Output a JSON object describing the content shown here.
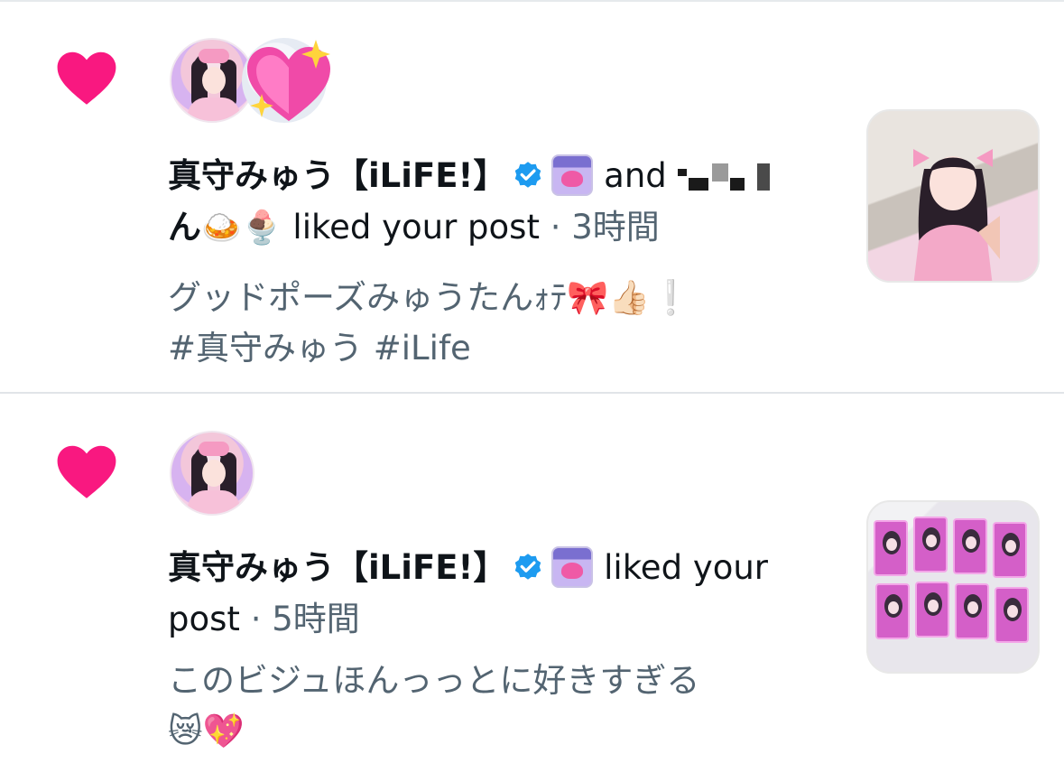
{
  "notifications": [
    {
      "type": "like",
      "user_name": "真守みゅう【iLiFE!】",
      "connector": "and",
      "second_user_suffix": "ん",
      "second_user_emojis": "🍛🍨",
      "action": "liked your post",
      "separator": "·",
      "time": "3時間",
      "post_text_line1": "グッドポーズみゅうたんｫﾃ🎀👍🏻❕",
      "post_text_line2": "#真守みゅう  #iLife",
      "avatar_icon": "user-avatar",
      "second_avatar_icon": "sparkling-heart-icon"
    },
    {
      "type": "like",
      "user_name": "真守みゅう【iLiFE!】",
      "action": "liked your",
      "action_line2": "post",
      "separator": "·",
      "time": "5時間",
      "post_text_line1": "このビジュほんっっとに好きすぎる",
      "post_text_line2": "😿💖",
      "avatar_icon": "user-avatar"
    }
  ],
  "colors": {
    "like_heart": "#f91880",
    "verified_badge": "#1d9bf0",
    "secondary_text": "#536471",
    "divider": "#e1e4e8"
  }
}
